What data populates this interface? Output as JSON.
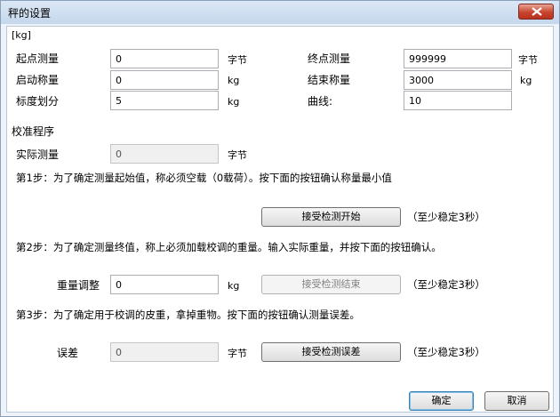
{
  "window": {
    "title": "秤的设置",
    "close_icon": "close-icon"
  },
  "unit_header": "[kg]",
  "params": {
    "start_measure": {
      "label": "起点测量",
      "value": "0",
      "unit": "字节"
    },
    "end_measure": {
      "label": "终点测量",
      "value": "999999",
      "unit": "字节"
    },
    "start_weight": {
      "label": "启动称量",
      "value": "0",
      "unit": "kg"
    },
    "end_weight": {
      "label": "结束称量",
      "value": "3000",
      "unit": "kg"
    },
    "division": {
      "label": "标度划分",
      "value": "5",
      "unit": "kg"
    },
    "curve": {
      "label": "曲线:",
      "value": "10"
    }
  },
  "calibration": {
    "section_label": "校准程序",
    "actual": {
      "label": "实际测量",
      "value": "0",
      "unit": "字节"
    },
    "step1": {
      "text": "第1步：为了确定测量起始值，称必须空载（0载荷）。按下面的按钮确认称量最小值",
      "button": "接受检测开始",
      "note": "（至少稳定3秒）"
    },
    "step2": {
      "text": "第2步：为了确定测量终值，称上必须加载校调的重量。输入实际重量，并按下面的按钮确认。",
      "field_label": "重量调整",
      "value": "0",
      "unit": "kg",
      "button": "接受检测结束",
      "note": "（至少稳定3秒）"
    },
    "step3": {
      "text": "第3步：为了确定用于校调的皮重，拿掉重物。按下面的按钮确认测量误差。",
      "field_label": "误差",
      "value": "0",
      "unit": "字节",
      "button": "接受检测误差",
      "note": "（至少稳定3秒）"
    }
  },
  "footer": {
    "ok": "确定",
    "cancel": "取消"
  }
}
